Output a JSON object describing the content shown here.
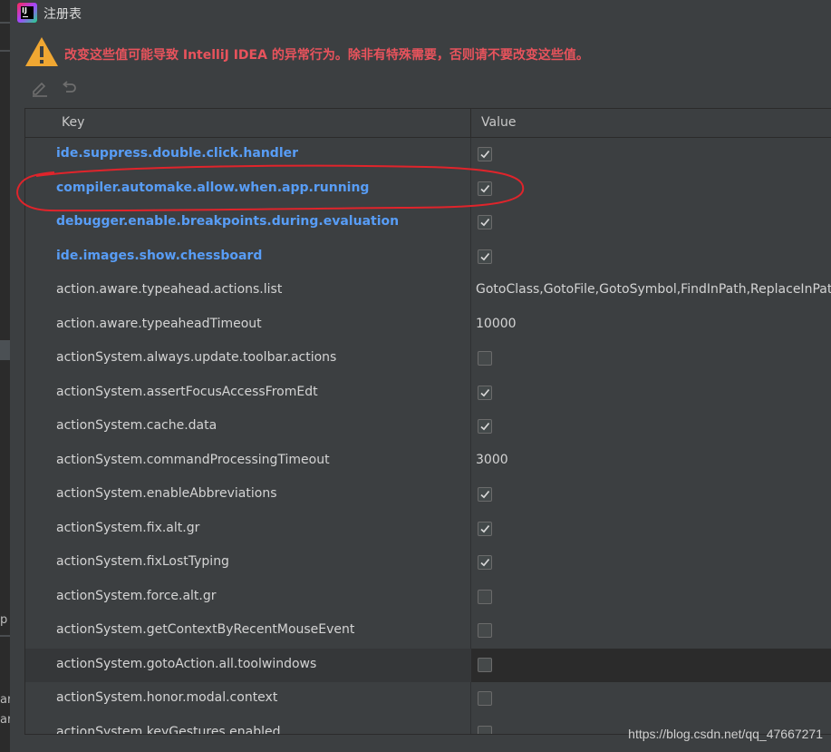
{
  "window": {
    "title": "注册表"
  },
  "warning": {
    "text": "改变这些值可能导致 IntelliJ IDEA 的异常行为。除非有特殊需要，否则请不要改变这些值。",
    "color": "#e8535c"
  },
  "toolbar": {
    "edit_icon": "pencil-icon",
    "revert_icon": "undo-icon"
  },
  "table": {
    "headers": {
      "key": "Key",
      "value": "Value"
    },
    "rows": [
      {
        "key": "ide.suppress.double.click.handler",
        "modified": true,
        "type": "checkbox",
        "checked": true
      },
      {
        "key": "compiler.automake.allow.when.app.running",
        "modified": true,
        "type": "checkbox",
        "checked": true
      },
      {
        "key": "debugger.enable.breakpoints.during.evaluation",
        "modified": true,
        "type": "checkbox",
        "checked": true
      },
      {
        "key": "ide.images.show.chessboard",
        "modified": true,
        "type": "checkbox",
        "checked": true
      },
      {
        "key": "action.aware.typeahead.actions.list",
        "modified": false,
        "type": "text",
        "value": "GotoClass,GotoFile,GotoSymbol,FindInPath,ReplaceInPath"
      },
      {
        "key": "action.aware.typeaheadTimeout",
        "modified": false,
        "type": "text",
        "value": "10000"
      },
      {
        "key": "actionSystem.always.update.toolbar.actions",
        "modified": false,
        "type": "checkbox",
        "checked": false
      },
      {
        "key": "actionSystem.assertFocusAccessFromEdt",
        "modified": false,
        "type": "checkbox",
        "checked": true
      },
      {
        "key": "actionSystem.cache.data",
        "modified": false,
        "type": "checkbox",
        "checked": true
      },
      {
        "key": "actionSystem.commandProcessingTimeout",
        "modified": false,
        "type": "text",
        "value": "3000"
      },
      {
        "key": "actionSystem.enableAbbreviations",
        "modified": false,
        "type": "checkbox",
        "checked": true
      },
      {
        "key": "actionSystem.fix.alt.gr",
        "modified": false,
        "type": "checkbox",
        "checked": true
      },
      {
        "key": "actionSystem.fixLostTyping",
        "modified": false,
        "type": "checkbox",
        "checked": true
      },
      {
        "key": "actionSystem.force.alt.gr",
        "modified": false,
        "type": "checkbox",
        "checked": false
      },
      {
        "key": "actionSystem.getContextByRecentMouseEvent",
        "modified": false,
        "type": "checkbox",
        "checked": false
      },
      {
        "key": "actionSystem.gotoAction.all.toolwindows",
        "modified": false,
        "type": "checkbox",
        "checked": false,
        "highlight": true
      },
      {
        "key": "actionSystem.honor.modal.context",
        "modified": false,
        "type": "checkbox",
        "checked": false
      },
      {
        "key": "actionSystem.keyGestures.enabled",
        "modified": false,
        "type": "checkbox",
        "checked": false
      }
    ]
  },
  "annotation": {
    "color": "#e0242b",
    "shape": "ellipse",
    "target_row": "compiler.automake.allow.when.app.running"
  },
  "watermark": "https://blog.csdn.net/qq_47667271",
  "background_ide": {
    "left_glyphs": [
      "p",
      "ar",
      "ar"
    ]
  }
}
